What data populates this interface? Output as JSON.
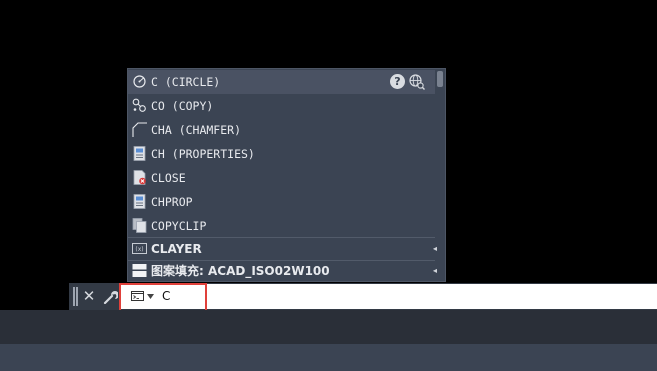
{
  "autocomplete": {
    "items": [
      {
        "label": "C (CIRCLE)",
        "icon": "circle-command-icon"
      },
      {
        "label": "CO (COPY)",
        "icon": "copy-command-icon"
      },
      {
        "label": "CHA (CHAMFER)",
        "icon": "chamfer-command-icon"
      },
      {
        "label": "CH (PROPERTIES)",
        "icon": "properties-command-icon"
      },
      {
        "label": "CLOSE",
        "icon": "close-drawing-icon"
      },
      {
        "label": "CHPROP",
        "icon": "chprop-command-icon"
      },
      {
        "label": "COPYCLIP",
        "icon": "copyclip-command-icon"
      }
    ],
    "system_variables": [
      {
        "label": "CLAYER",
        "icon": "system-variable-icon"
      },
      {
        "label": "图案填充: ACAD_ISO02W100",
        "icon": "hatch-pattern-icon"
      }
    ],
    "help_glyph": "?"
  },
  "command_line": {
    "close_glyph": "✕",
    "input_value": "C"
  },
  "colors": {
    "panel": "#3b4453",
    "highlight": "#e0403a"
  }
}
